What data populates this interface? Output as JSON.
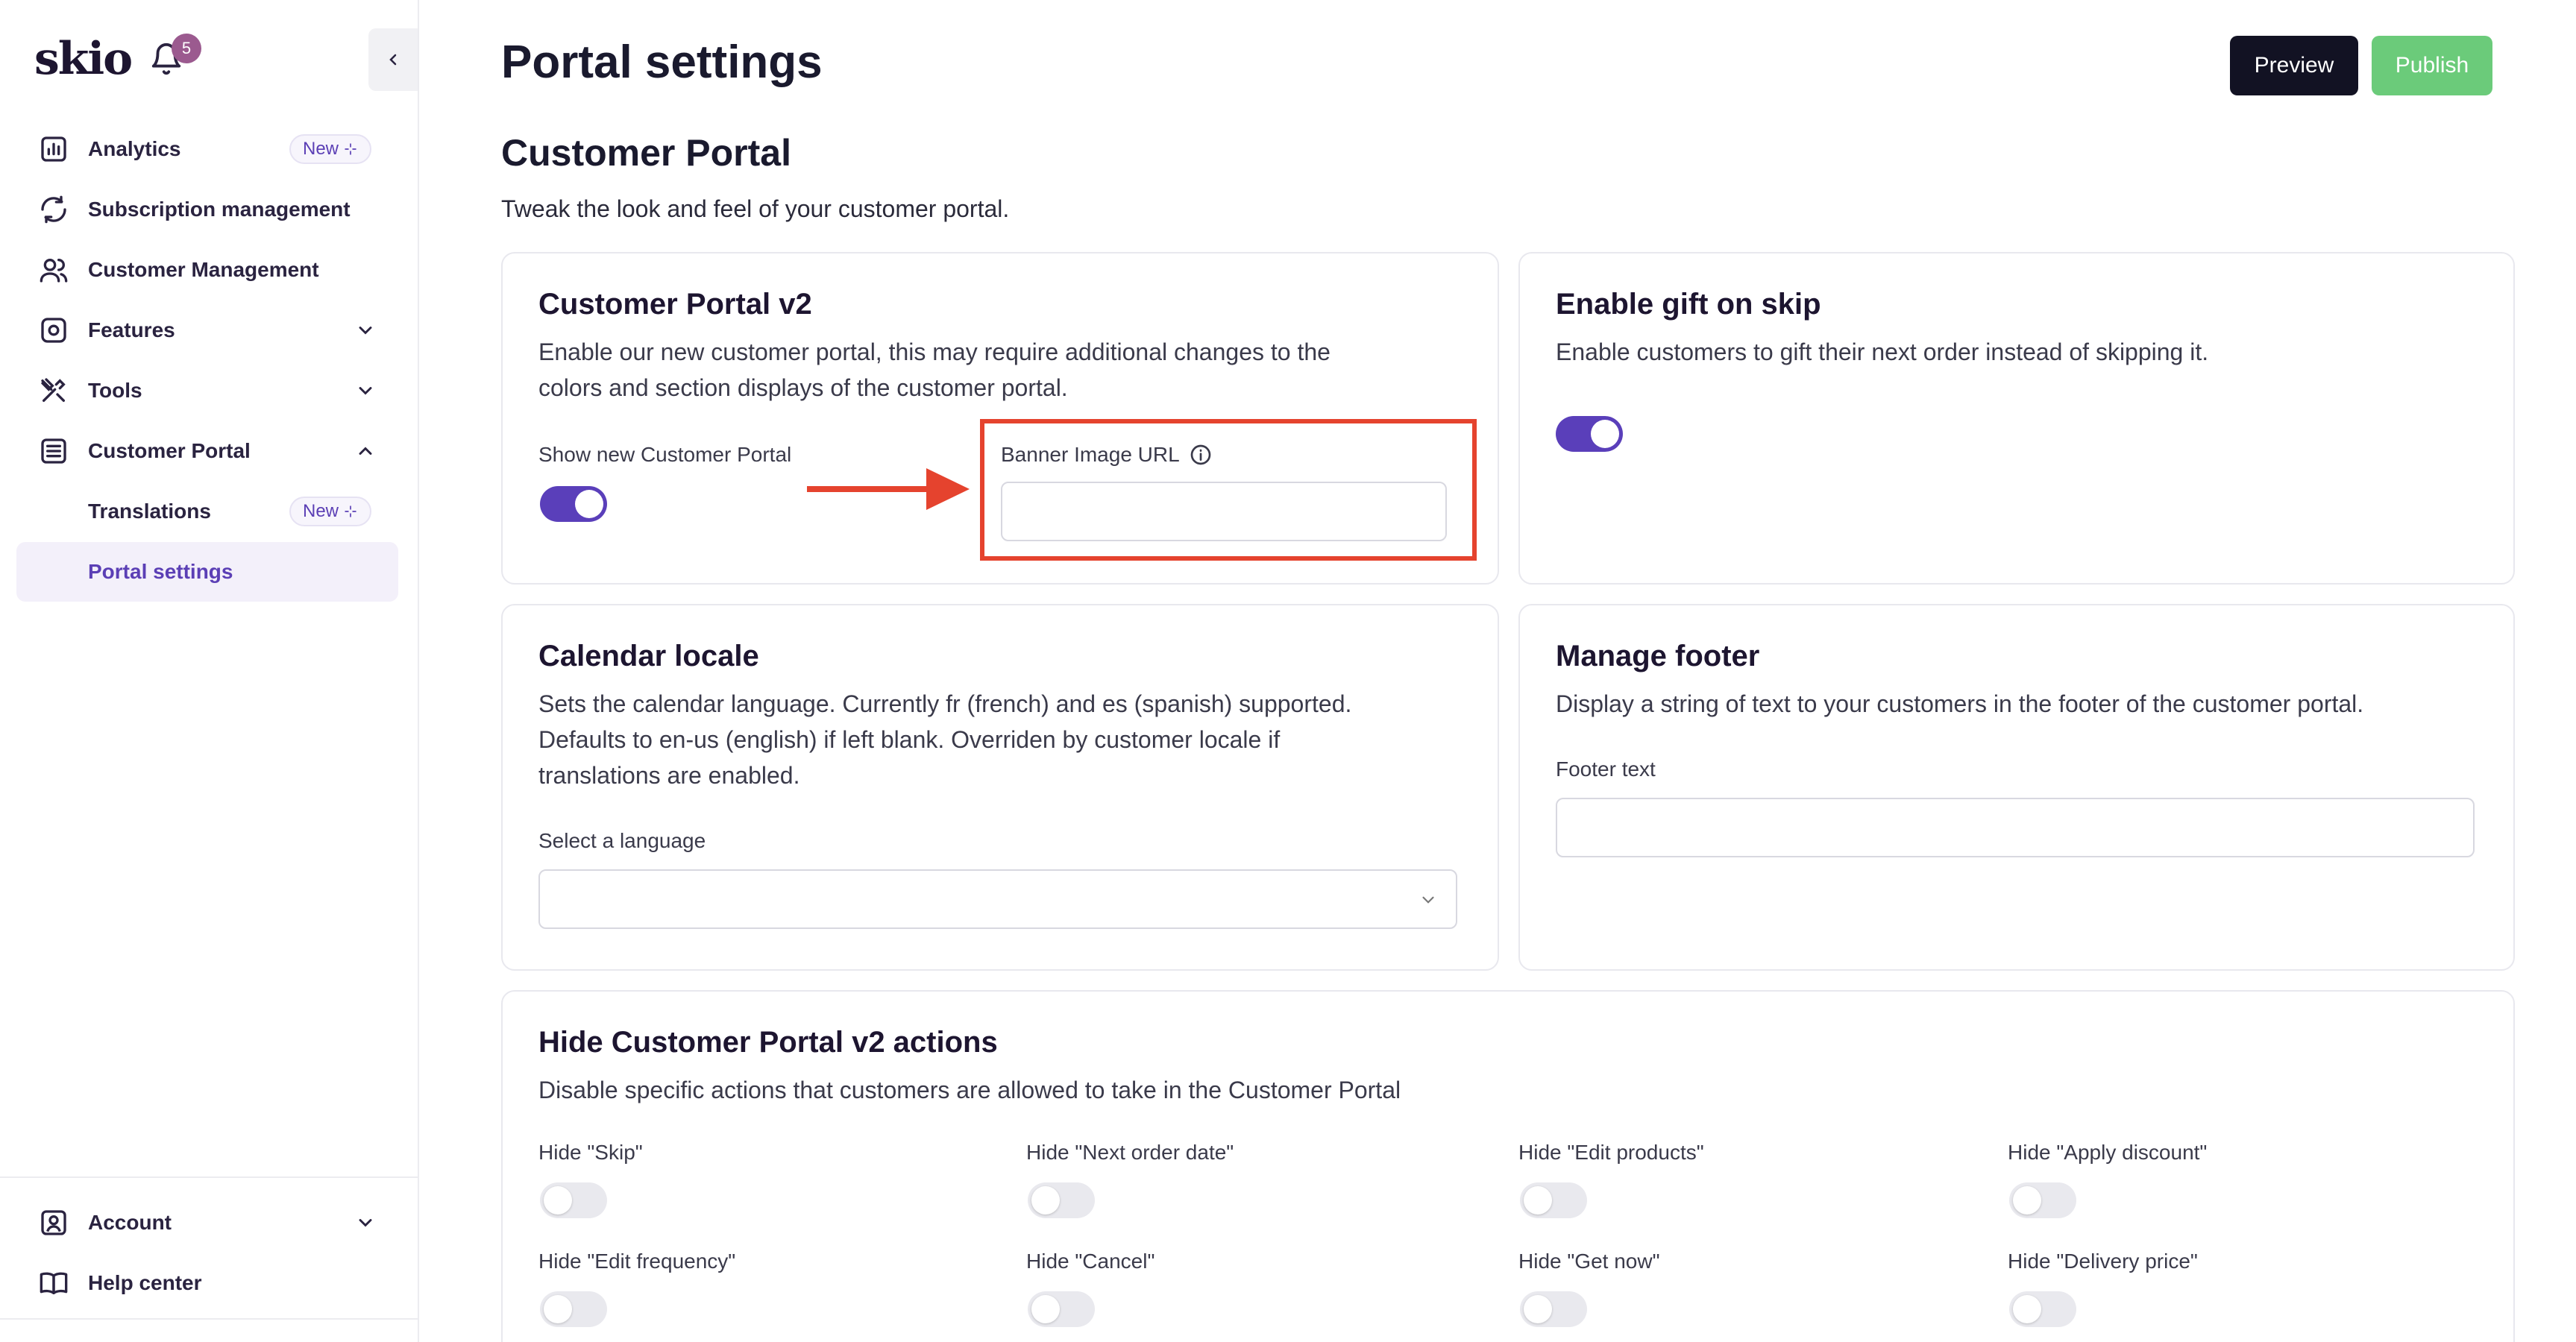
{
  "sidebar": {
    "logo": "skio",
    "notification_count": "5",
    "items": [
      {
        "label": "Analytics",
        "icon": "bar-chart-icon",
        "badge": "New"
      },
      {
        "label": "Subscription management",
        "icon": "refresh-icon"
      },
      {
        "label": "Customer Management",
        "icon": "users-icon"
      },
      {
        "label": "Features",
        "icon": "gear-icon"
      },
      {
        "label": "Tools",
        "icon": "tools-icon"
      },
      {
        "label": "Customer Portal",
        "icon": "portal-icon"
      },
      {
        "label": "Translations",
        "badge": "New"
      },
      {
        "label": "Portal settings"
      }
    ],
    "bottom": [
      {
        "label": "Account",
        "icon": "account-icon"
      },
      {
        "label": "Help center",
        "icon": "book-icon"
      }
    ]
  },
  "header": {
    "title": "Portal settings",
    "preview_label": "Preview",
    "publish_label": "Publish"
  },
  "section": {
    "title": "Customer Portal",
    "description": "Tweak the look and feel of your customer portal."
  },
  "cards": {
    "portal_v2": {
      "title": "Customer Portal v2",
      "desc_line1": "Enable our new customer portal, this may require additional changes to the",
      "desc_line2": "colors and section displays of the customer portal.",
      "toggle_label": "Show new Customer Portal",
      "toggle_on": true,
      "banner_label": "Banner Image URL",
      "banner_value": ""
    },
    "gift": {
      "title": "Enable gift on skip",
      "desc": "Enable customers to gift their next order instead of skipping it.",
      "toggle_on": true
    },
    "calendar": {
      "title": "Calendar locale",
      "desc_line1": "Sets the calendar language. Currently fr (french) and es (spanish) supported.",
      "desc_line2": "Defaults to en-us (english) if left blank. Overriden by customer locale if",
      "desc_line3": "translations are enabled.",
      "select_label": "Select a language",
      "select_value": ""
    },
    "footer": {
      "title": "Manage footer",
      "desc": "Display a string of text to your customers in the footer of the customer portal.",
      "field_label": "Footer text",
      "field_value": ""
    },
    "hide_actions": {
      "title": "Hide Customer Portal v2 actions",
      "desc": "Disable specific actions that customers are allowed to take in the Customer Portal",
      "actions": [
        "Hide \"Skip\"",
        "Hide \"Next order date\"",
        "Hide \"Edit products\"",
        "Hide \"Apply discount\"",
        "Hide \"Edit frequency\"",
        "Hide \"Cancel\"",
        "Hide \"Get now\"",
        "Hide \"Delivery price\""
      ]
    }
  },
  "colors": {
    "accent": "#5a3fba",
    "publish": "#6bcb7a",
    "highlight": "#e5432e"
  }
}
